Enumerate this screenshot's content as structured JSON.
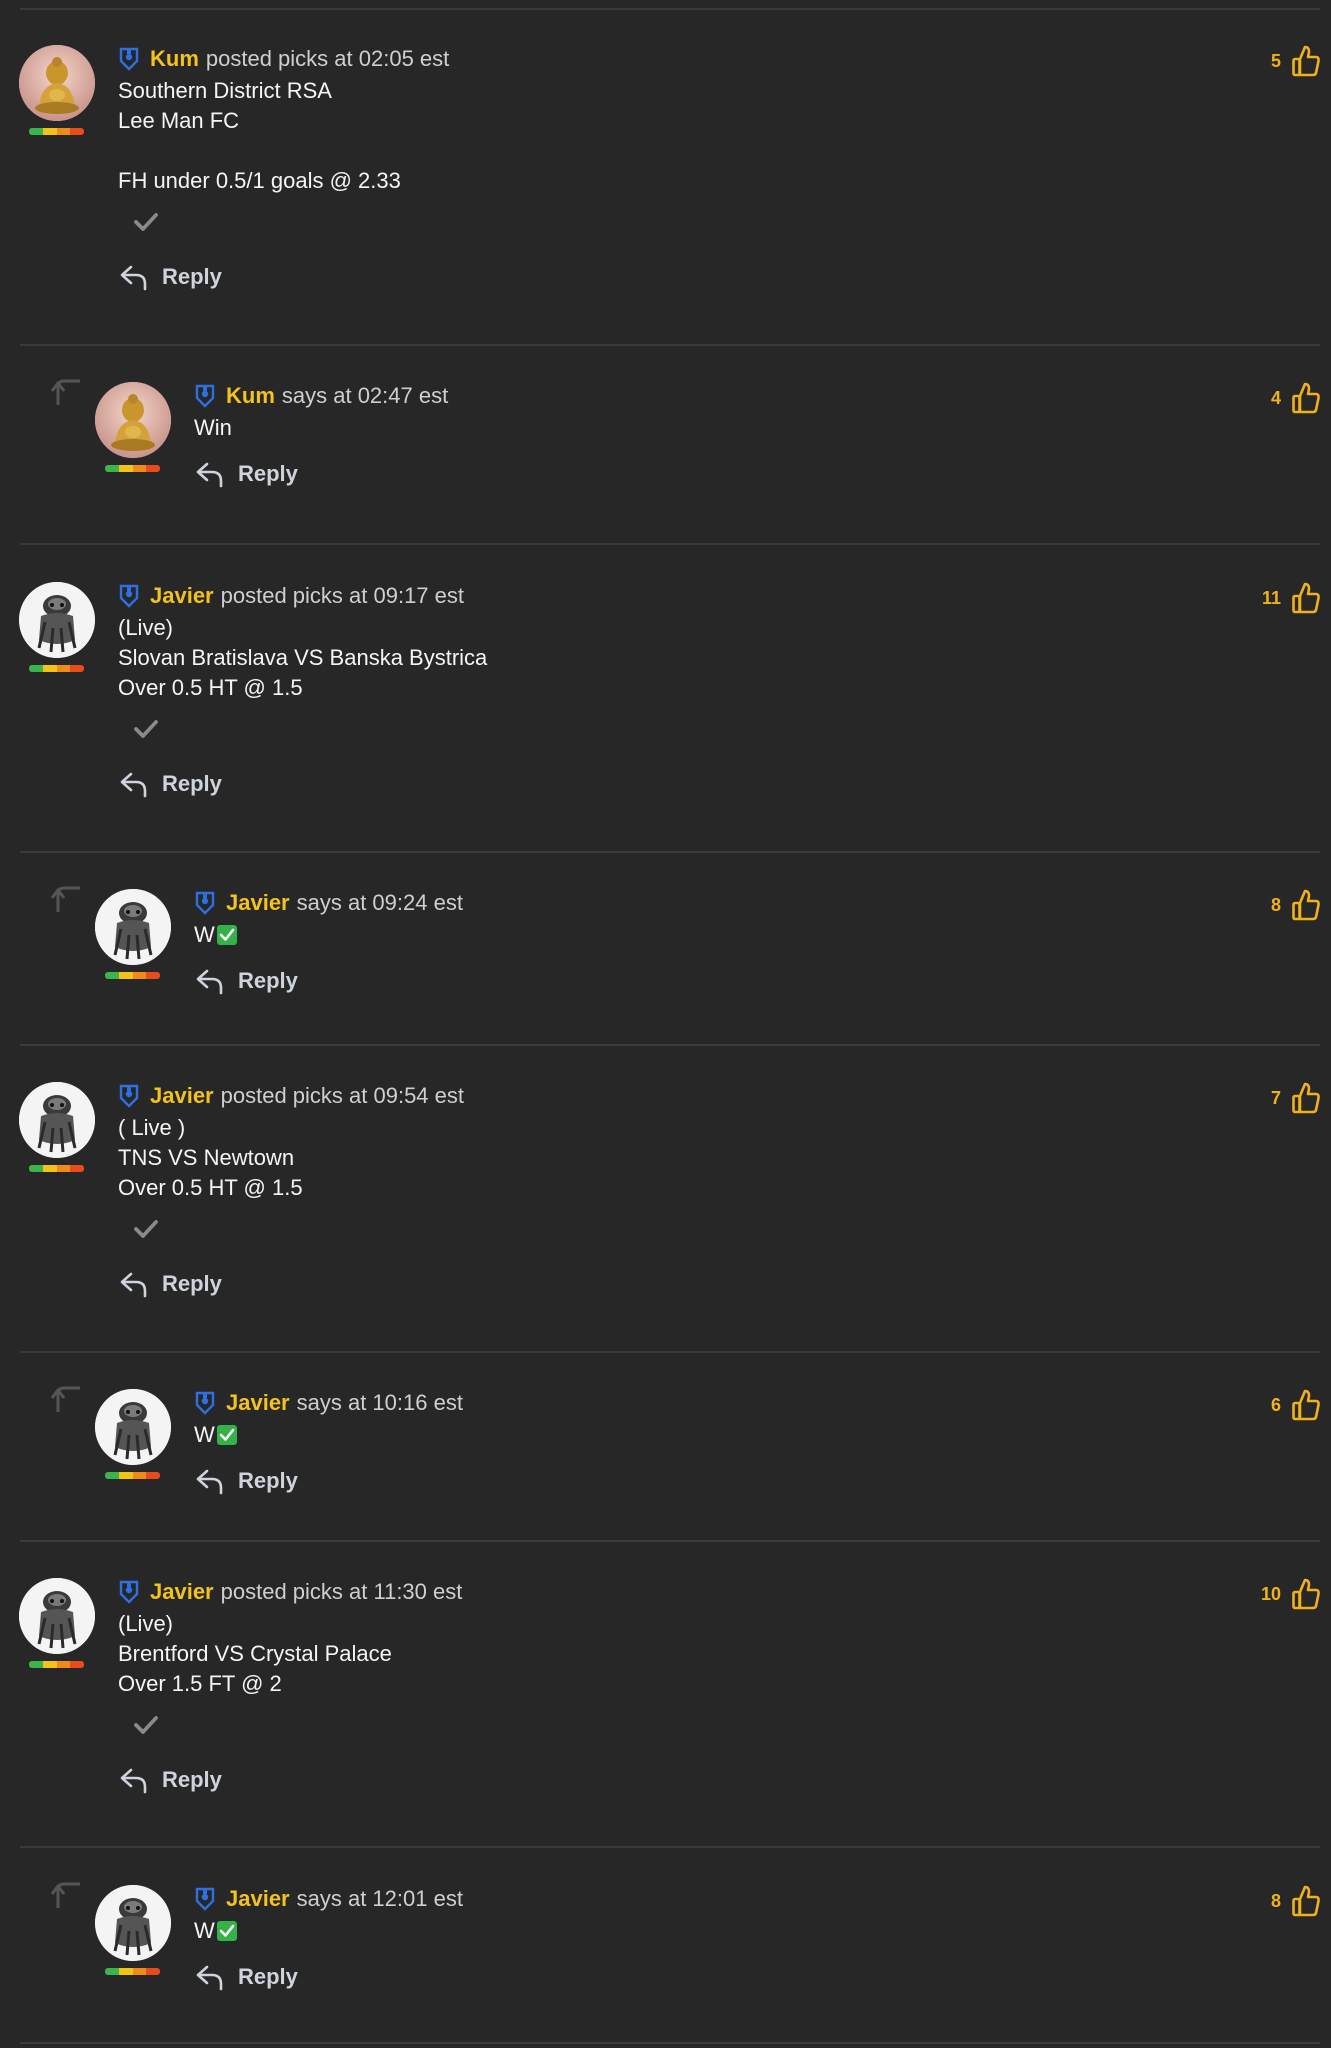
{
  "posts": [
    {
      "kind": "pick",
      "avatar": "buddha-statue",
      "author": "Kum",
      "meta": "posted picks at 02:05 est",
      "lines": [
        "Southern District RSA",
        "Lee Man FC",
        "",
        "FH under 0.5/1 goals @ 2.33"
      ],
      "likes": "5",
      "reply_label": "Reply",
      "has_check": true
    },
    {
      "kind": "reply",
      "avatar": "buddha-statue",
      "author": "Kum",
      "meta": "says at 02:47 est",
      "lines": [
        "Win"
      ],
      "likes": "4",
      "reply_label": "Reply",
      "has_check": false
    },
    {
      "kind": "pick",
      "avatar": "stone-creature",
      "author": "Javier",
      "meta": "posted picks at 09:17 est",
      "lines": [
        "(Live)",
        "Slovan Bratislava VS Banska Bystrica",
        "Over 0.5 HT @ 1.5"
      ],
      "likes": "11",
      "reply_label": "Reply",
      "has_check": true
    },
    {
      "kind": "reply",
      "avatar": "stone-creature",
      "author": "Javier",
      "meta": "says at 09:24 est",
      "lines": [
        "W"
      ],
      "emoji_check": true,
      "likes": "8",
      "reply_label": "Reply",
      "has_check": false
    },
    {
      "kind": "pick",
      "avatar": "stone-creature",
      "author": "Javier",
      "meta": "posted picks at 09:54 est",
      "lines": [
        "( Live )",
        "TNS VS Newtown",
        "Over 0.5 HT @ 1.5"
      ],
      "likes": "7",
      "reply_label": "Reply",
      "has_check": true
    },
    {
      "kind": "reply",
      "avatar": "stone-creature",
      "author": "Javier",
      "meta": "says at 10:16 est",
      "lines": [
        "W"
      ],
      "emoji_check": true,
      "likes": "6",
      "reply_label": "Reply",
      "has_check": false
    },
    {
      "kind": "pick",
      "avatar": "stone-creature",
      "author": "Javier",
      "meta": "posted picks at 11:30 est",
      "lines": [
        "(Live)",
        "Brentford VS Crystal Palace",
        "Over 1.5 FT @ 2"
      ],
      "likes": "10",
      "reply_label": "Reply",
      "has_check": true
    },
    {
      "kind": "reply",
      "avatar": "stone-creature",
      "author": "Javier",
      "meta": "says at 12:01 est",
      "lines": [
        "W"
      ],
      "emoji_check": true,
      "likes": "8",
      "reply_label": "Reply",
      "has_check": false
    }
  ],
  "colors": {
    "background": "#272727",
    "author": "#f4c21c",
    "likes": "#f0b21c",
    "badge": "#2f6fe0",
    "separator": "#3a3a3a"
  }
}
